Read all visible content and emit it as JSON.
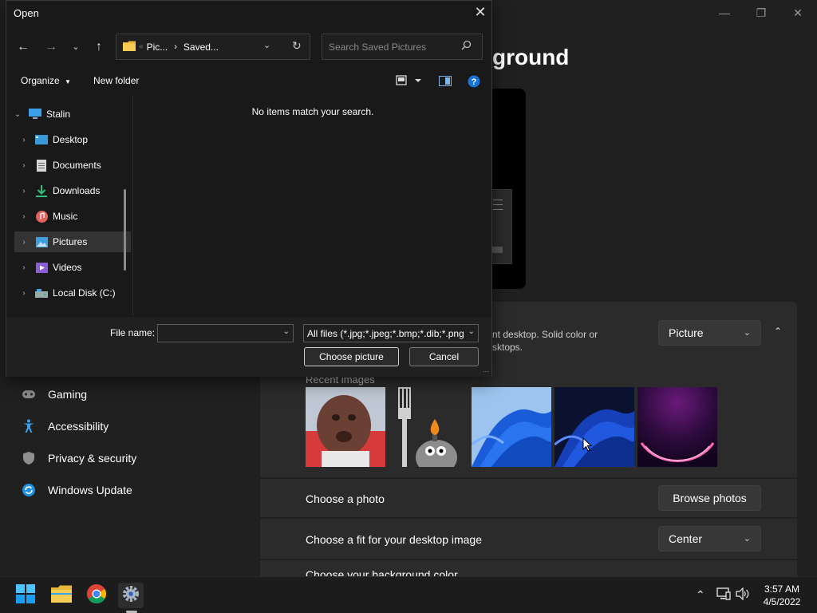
{
  "settings": {
    "page_title_partial": "ground",
    "nav": {
      "gaming": "Gaming",
      "accessibility": "Accessibility",
      "privacy": "Privacy & security",
      "windows_update": "Windows Update"
    },
    "background": {
      "description_line1": "nt desktop. Solid color or",
      "description_line2": "sktops.",
      "type_value": "Picture",
      "recent_images_label": "Recent images",
      "choose_photo_label": "Choose a photo",
      "browse_photos_label": "Browse photos",
      "fit_label": "Choose a fit for your desktop image",
      "fit_value": "Center",
      "color_label_partial": "Choose your background color"
    },
    "window_controls": {
      "minimize": "—",
      "maximize": "❐",
      "close": "✕"
    }
  },
  "dialog": {
    "title": "Open",
    "address": {
      "crumb1": "Pic...",
      "crumb2": "Saved..."
    },
    "search_placeholder": "Search Saved Pictures",
    "toolbar": {
      "organize": "Organize",
      "new_folder": "New folder"
    },
    "tree": {
      "root": "Stalin",
      "items": [
        "Desktop",
        "Documents",
        "Downloads",
        "Music",
        "Pictures",
        "Videos",
        "Local Disk (C:)"
      ],
      "selected": "Pictures"
    },
    "empty_message": "No items match your search.",
    "file_name_label": "File name:",
    "file_name_value": "",
    "file_type": "All files (*.jpg;*.jpeg;*.bmp;*.dib;*.png",
    "choose_button": "Choose picture",
    "cancel_button": "Cancel"
  },
  "taskbar": {
    "time": "3:57 AM",
    "date": "4/5/2022"
  },
  "colors": {
    "accent": "#0078d4",
    "dialog_bg": "#191919",
    "settings_bg": "#202020",
    "card_bg": "#2b2b2b"
  }
}
